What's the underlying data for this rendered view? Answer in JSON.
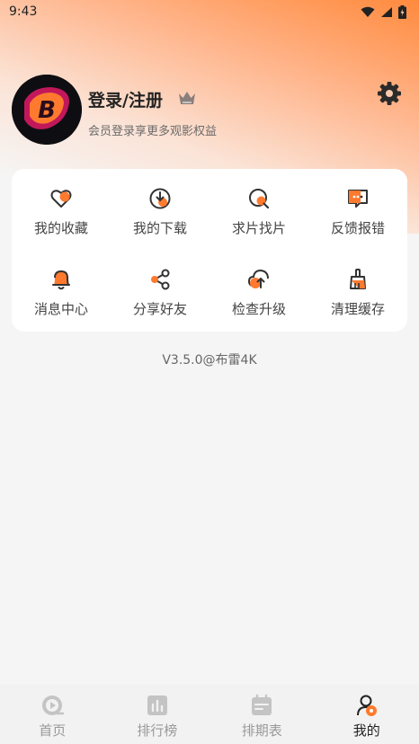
{
  "status_bar": {
    "time": "9:43"
  },
  "profile": {
    "login_label": "登录/注册",
    "subtitle": "会员登录享更多观影权益"
  },
  "menu": [
    {
      "label": "我的收藏",
      "icon": "heart-icon"
    },
    {
      "label": "我的下载",
      "icon": "download-icon"
    },
    {
      "label": "求片找片",
      "icon": "search-film-icon"
    },
    {
      "label": "反馈报错",
      "icon": "feedback-icon"
    },
    {
      "label": "消息中心",
      "icon": "bell-icon"
    },
    {
      "label": "分享好友",
      "icon": "share-icon"
    },
    {
      "label": "检查升级",
      "icon": "upgrade-icon"
    },
    {
      "label": "清理缓存",
      "icon": "broom-icon"
    }
  ],
  "version": "V3.5.0@布雷4K",
  "bottom_nav": [
    {
      "label": "首页",
      "icon": "home-icon"
    },
    {
      "label": "排行榜",
      "icon": "ranking-icon"
    },
    {
      "label": "排期表",
      "icon": "schedule-icon"
    },
    {
      "label": "我的",
      "icon": "profile-icon",
      "active": true
    }
  ],
  "colors": {
    "accent": "#ff7a2e",
    "nav_inactive": "#bdbdbd"
  }
}
